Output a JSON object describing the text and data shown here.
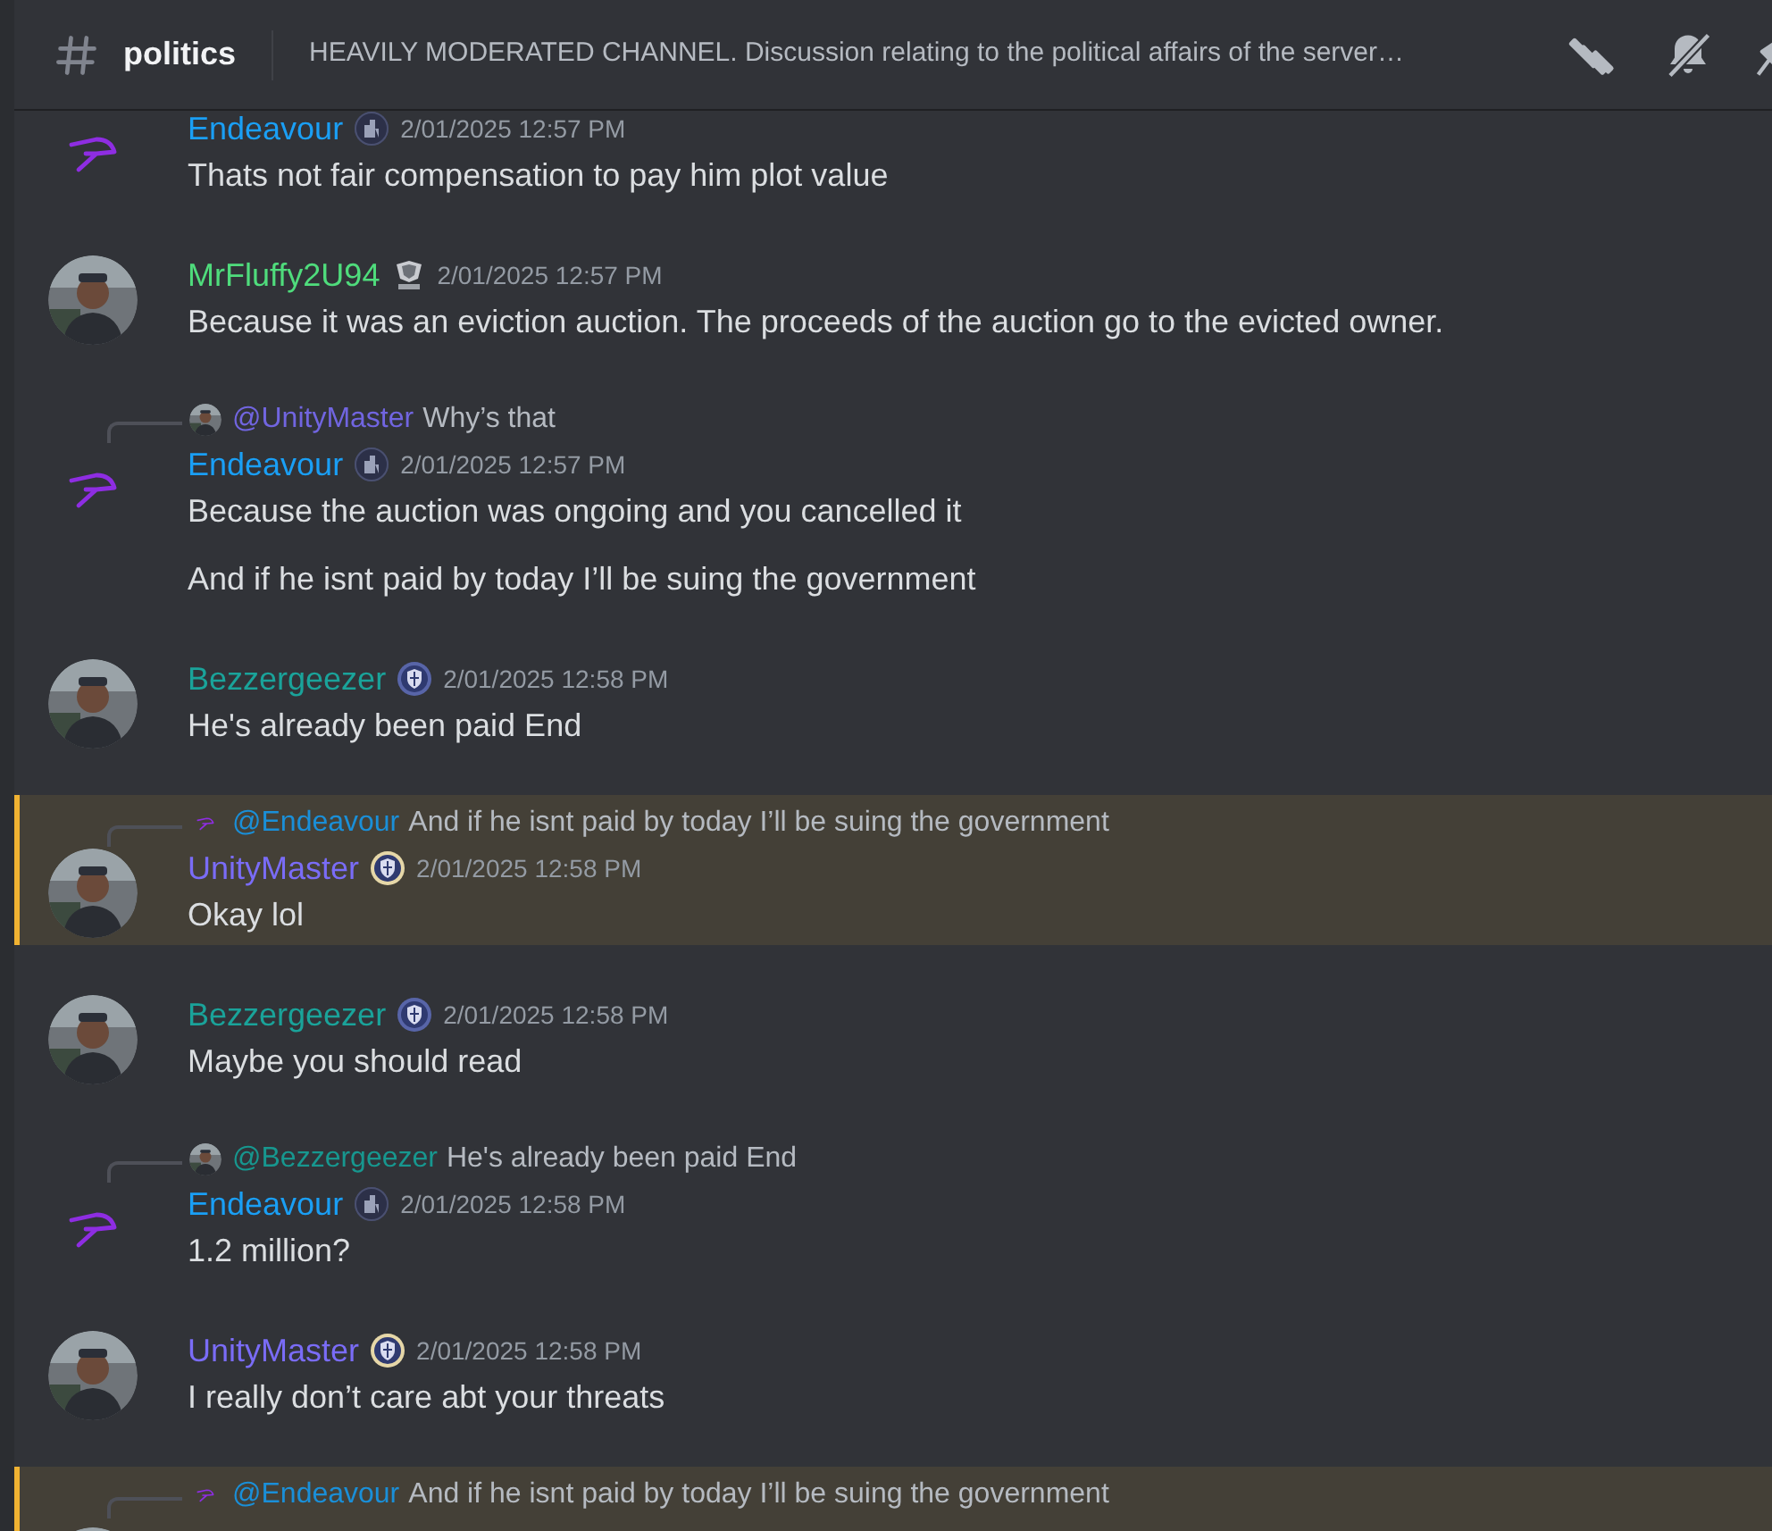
{
  "header": {
    "channel": "politics",
    "topic": "HEAVILY MODERATED CHANNEL. Discussion relating to the political affairs of the server…"
  },
  "messages": [
    {
      "author": {
        "name": "Endeavour",
        "color": "#1a9ff5",
        "badge": {
          "kind": "building"
        },
        "avatar": {
          "kind": "glyph"
        }
      },
      "timestamp": "2/01/2025 12:57 PM",
      "text": "Thats not fair compensation to pay him plot value",
      "highlighted": false
    },
    {
      "author": {
        "name": "MrFluffy2U94",
        "color": "#4fdc7c",
        "badge": {
          "kind": "emblem"
        }
      },
      "timestamp": "2/01/2025 12:57 PM",
      "text": "Because it was an eviction auction. The proceeds of the auction go to the evicted owner.",
      "highlighted": false
    },
    {
      "reply": {
        "author": "@UnityMaster",
        "color": "#7165e0",
        "text": "Why’s that"
      },
      "author": {
        "name": "Endeavour",
        "color": "#1a9ff5",
        "badge": {
          "kind": "building"
        },
        "avatar": {
          "kind": "glyph"
        }
      },
      "timestamp": "2/01/2025 12:57 PM",
      "text": "Because the auction was ongoing and you cancelled it",
      "highlighted": false
    },
    {
      "text": "And if he isnt paid by today I’ll be suing the government",
      "highlighted": false
    },
    {
      "author": {
        "name": "Bezzergeezer",
        "color": "#1aa39a",
        "badge": {
          "kind": "shield"
        }
      },
      "timestamp": "2/01/2025 12:58 PM",
      "text": "He's already been paid End",
      "highlighted": false
    },
    {
      "reply": {
        "author": "@Endeavour",
        "color": "#1a8fd8",
        "avatar": {
          "kind": "glyph"
        },
        "text": "And if he isnt paid by today I’ll be suing the government"
      },
      "author": {
        "name": "UnityMaster",
        "color": "#7a6cf7",
        "badge": {
          "kind": "shield-gold"
        }
      },
      "timestamp": "2/01/2025 12:58 PM",
      "text": "Okay lol",
      "highlighted": true
    },
    {
      "author": {
        "name": "Bezzergeezer",
        "color": "#1aa39a",
        "badge": {
          "kind": "shield"
        }
      },
      "timestamp": "2/01/2025 12:58 PM",
      "text": "Maybe you should read",
      "highlighted": false
    },
    {
      "reply": {
        "author": "@Bezzergeezer",
        "color": "#17978f",
        "text": "He's already been paid End"
      },
      "author": {
        "name": "Endeavour",
        "color": "#1a9ff5",
        "badge": {
          "kind": "building"
        },
        "avatar": {
          "kind": "glyph"
        }
      },
      "timestamp": "2/01/2025 12:58 PM",
      "text": "1.2 million?",
      "highlighted": false
    },
    {
      "author": {
        "name": "UnityMaster",
        "color": "#7a6cf7",
        "badge": {
          "kind": "shield-gold"
        }
      },
      "timestamp": "2/01/2025 12:58 PM",
      "text": "I really don’t care abt your threats",
      "highlighted": false
    },
    {
      "reply": {
        "author": "@Endeavour",
        "color": "#1a8fd8",
        "avatar": {
          "kind": "glyph"
        },
        "text": "And if he isnt paid by today I’ll be suing the government"
      },
      "highlighted": true
    }
  ]
}
